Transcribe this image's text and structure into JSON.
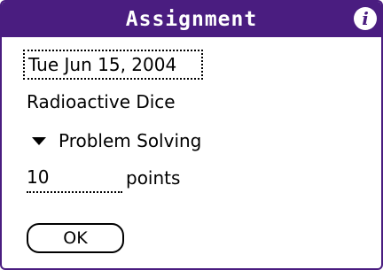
{
  "dialog": {
    "title": "Assignment",
    "info_icon": "info-icon",
    "accent_color": "#4a1d80"
  },
  "form": {
    "date": "Tue Jun 15, 2004",
    "assignment_name": "Radioactive Dice",
    "category": "Problem Solving",
    "category_icon": "triangle-down-icon",
    "points_value": "10",
    "points_unit": "points"
  },
  "buttons": {
    "ok_label": "OK"
  }
}
